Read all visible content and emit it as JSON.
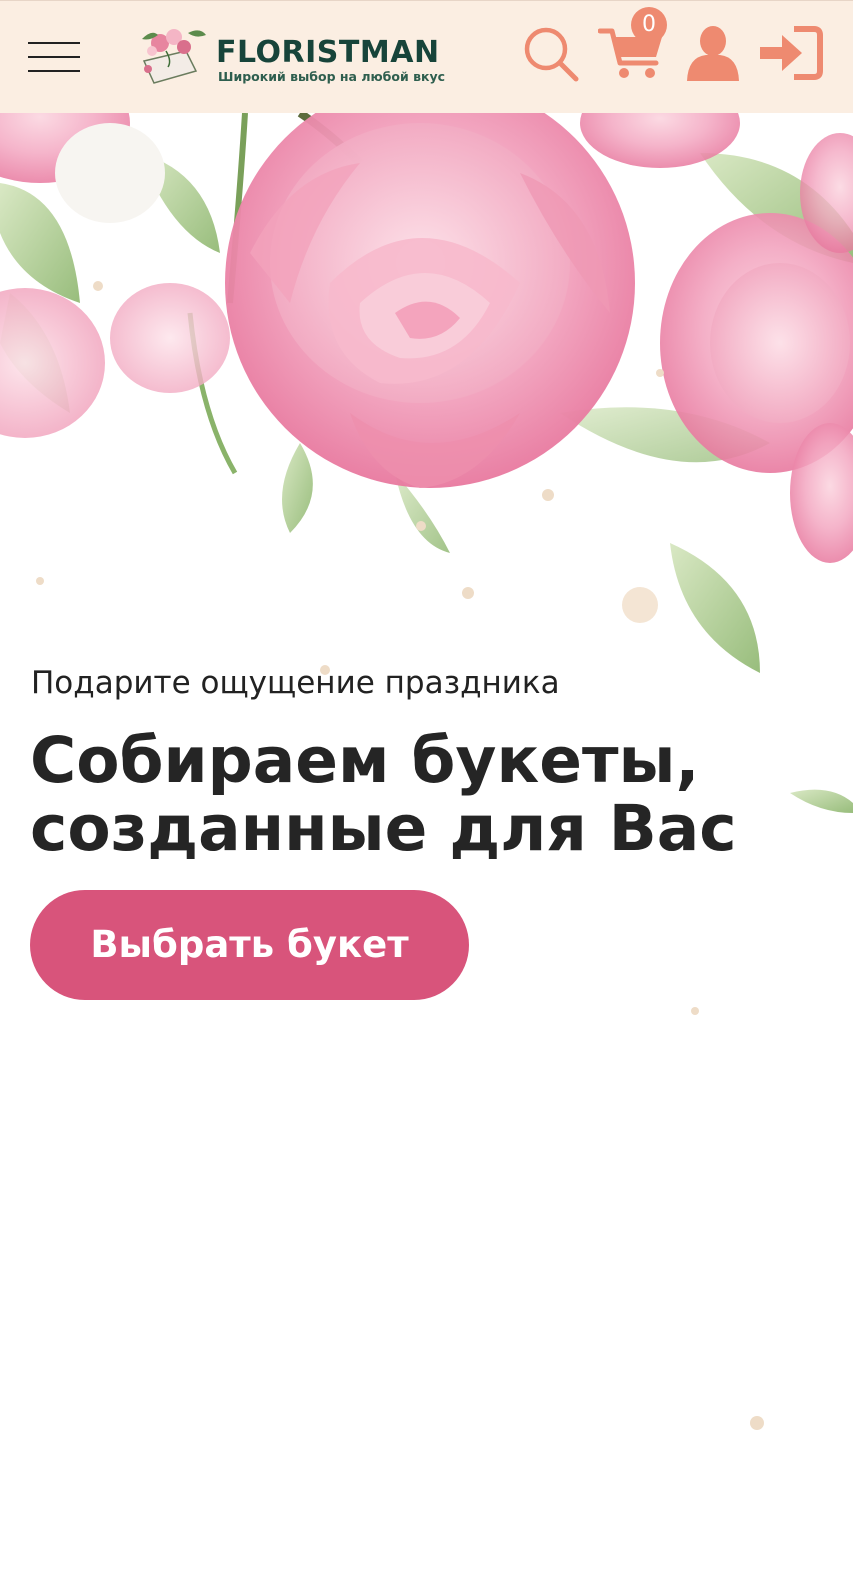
{
  "header": {
    "menu_label": "",
    "logo": {
      "name": "FLORISTMAN",
      "tagline": "Широкий выбор на любой вкус"
    },
    "icons": {
      "search": "search-icon",
      "cart": "cart-icon",
      "user": "user-icon",
      "login": "login-icon"
    },
    "cart_count": "0"
  },
  "hero": {
    "subtitle": "Подарите ощущение праздника",
    "title_line1": "Собираем букеты,",
    "title_line2": "созданные для Вас",
    "cta_label": "Выбрать букет"
  },
  "colors": {
    "header_bg": "#fbeee2",
    "accent_icon": "#ee8a70",
    "cta_bg": "#d8547b",
    "logo_green": "#17443a",
    "peony_pink": "#f1a3bf",
    "leaf_green": "#a9c98c"
  }
}
